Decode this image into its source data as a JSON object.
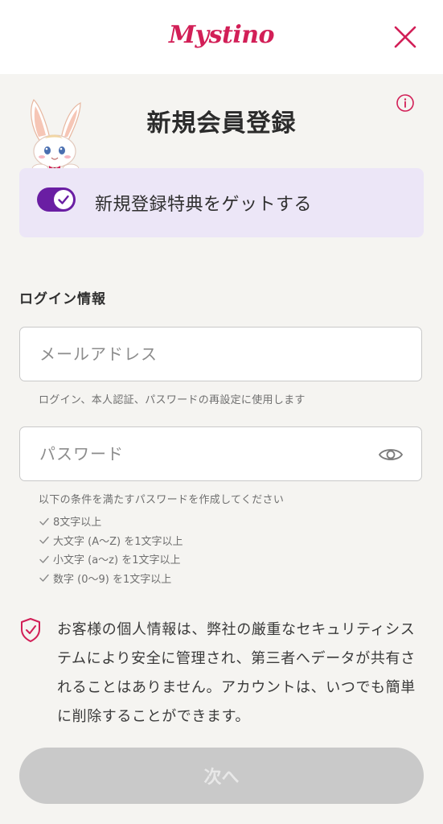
{
  "header": {
    "logo_text": "Mystino",
    "close_icon": "close-icon",
    "brand_color": "#d21f57"
  },
  "page": {
    "title": "新規会員登録",
    "info_icon": "info-icon"
  },
  "bonus": {
    "toggle_on": true,
    "label": "新規登録特典をゲットする",
    "accent_color": "#6a1ea3",
    "panel_color": "#ece6f7"
  },
  "login_section": {
    "heading": "ログイン情報",
    "email": {
      "placeholder": "メールアドレス",
      "value": "",
      "hint": "ログイン、本人認証、パスワードの再設定に使用します"
    },
    "password": {
      "placeholder": "パスワード",
      "value": "",
      "visibility_icon": "eye-icon",
      "hint": "以下の条件を満たすパスワードを作成してください",
      "requirements": [
        "8文字以上",
        "大文字 (A〜Z) を1文字以上",
        "小文字 (a〜z) を1文字以上",
        "数字 (0〜9) を1文字以上"
      ]
    }
  },
  "privacy": {
    "icon": "shield-check-icon",
    "text": "お客様の個人情報は、弊社の厳重なセキュリティシステムにより安全に管理され、第三者へデータが共有されることはありません。アカウントは、いつでも簡単に削除することができます。"
  },
  "footer": {
    "next_label": "次へ",
    "next_enabled": false
  }
}
